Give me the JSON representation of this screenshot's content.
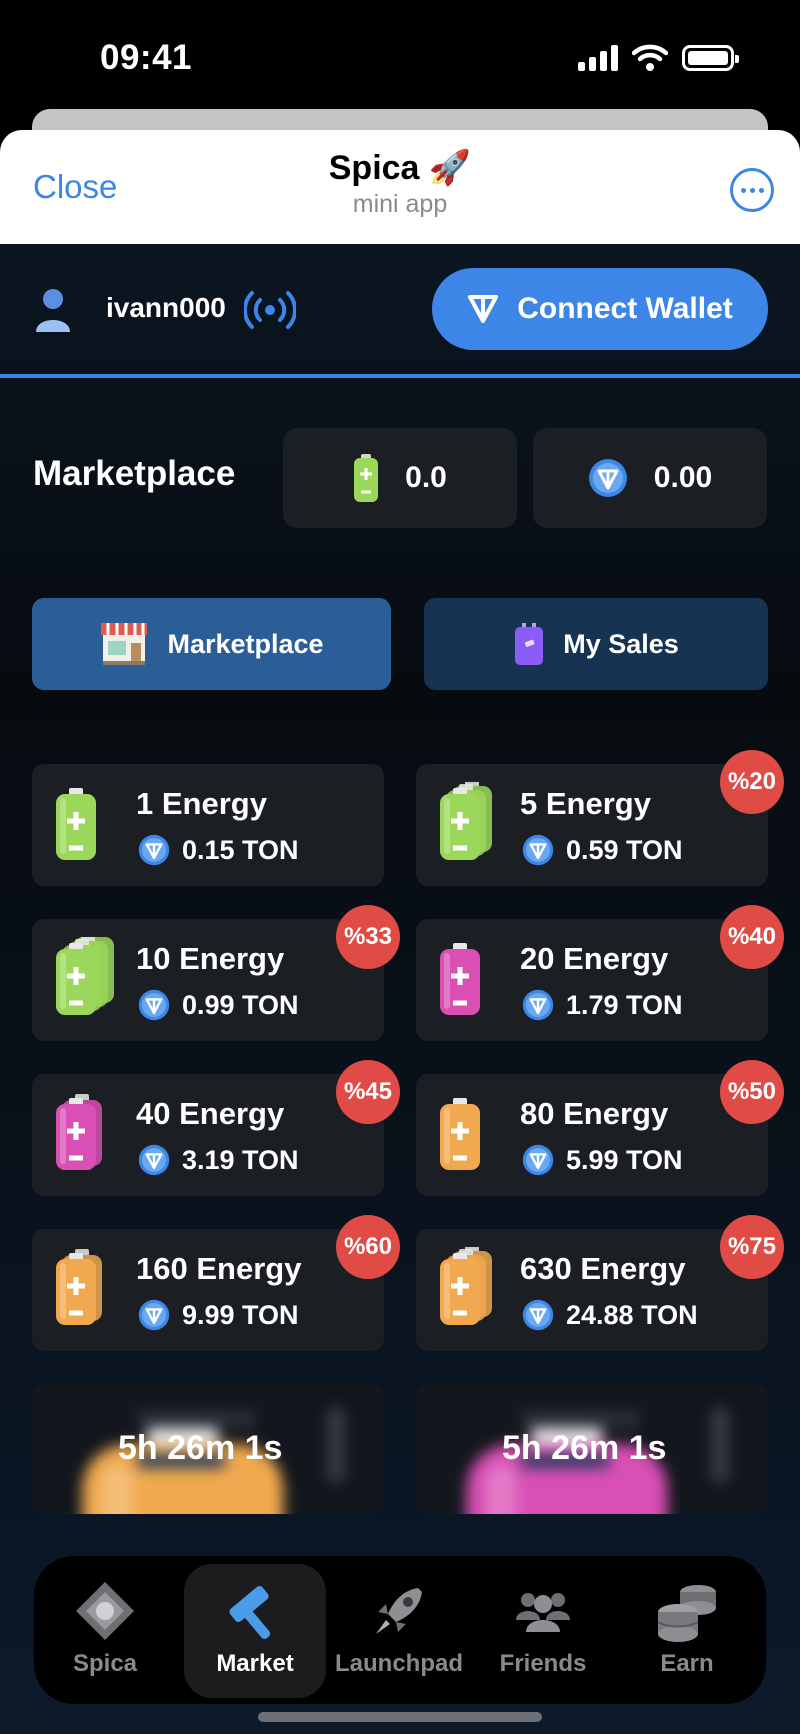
{
  "status": {
    "time": "09:41"
  },
  "header": {
    "close_label": "Close",
    "title": "Spica 🚀",
    "subtitle": "mini app",
    "more_icon": "more-icon"
  },
  "user": {
    "username": "ivann000",
    "connect_label": "Connect Wallet"
  },
  "market": {
    "title": "Marketplace",
    "energy_balance": "0.0",
    "ton_balance": "0.00",
    "tabs": [
      {
        "label": "Marketplace"
      },
      {
        "label": "My Sales"
      }
    ]
  },
  "offers": [
    {
      "title": "1 Energy",
      "price": "0.15 TON",
      "badge": "",
      "color": "#9bd75a",
      "stack": 1
    },
    {
      "title": "5 Energy",
      "price": "0.59 TON",
      "badge": "%20",
      "color": "#9bd75a",
      "stack": 3
    },
    {
      "title": "10 Energy",
      "price": "0.99 TON",
      "badge": "%33",
      "color": "#9bd75a",
      "stack": 4
    },
    {
      "title": "20 Energy",
      "price": "1.79 TON",
      "badge": "%40",
      "color": "#d94fb4",
      "stack": 1
    },
    {
      "title": "40 Energy",
      "price": "3.19 TON",
      "badge": "%45",
      "color": "#d94fb4",
      "stack": 2
    },
    {
      "title": "80 Energy",
      "price": "5.99 TON",
      "badge": "%50",
      "color": "#f0a94e",
      "stack": 1
    },
    {
      "title": "160 Energy",
      "price": "9.99 TON",
      "badge": "%60",
      "color": "#f0a94e",
      "stack": 2
    },
    {
      "title": "630 Energy",
      "price": "24.88 TON",
      "badge": "%75",
      "color": "#f0a94e",
      "stack": 3
    }
  ],
  "locked": [
    {
      "timer": "5h 26m 1s",
      "color": "#f0a94e"
    },
    {
      "timer": "5h 26m 1s",
      "color": "#d94fb4"
    }
  ],
  "nav": [
    {
      "label": "Spica",
      "icon": "spica-icon"
    },
    {
      "label": "Market",
      "icon": "hammer-icon"
    },
    {
      "label": "Launchpad",
      "icon": "rocket-icon"
    },
    {
      "label": "Friends",
      "icon": "friends-icon"
    },
    {
      "label": "Earn",
      "icon": "coins-icon"
    }
  ],
  "colors": {
    "accent": "#3d86e8",
    "badge": "#e04b45",
    "card": "#1b1e23"
  }
}
